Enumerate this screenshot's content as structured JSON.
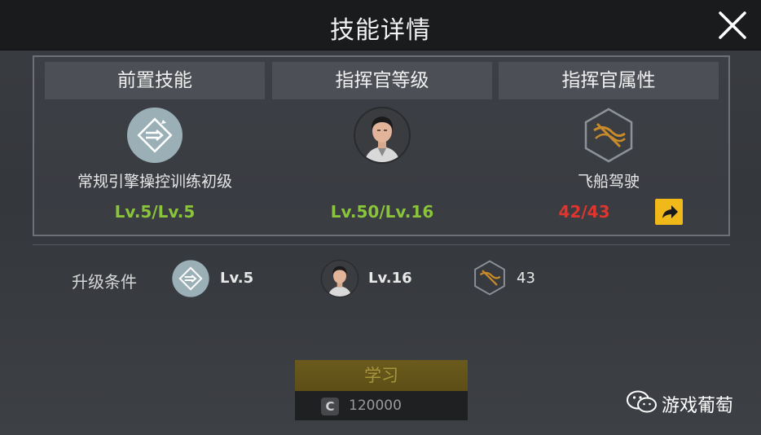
{
  "header": {
    "title": "技能详情"
  },
  "columns": [
    {
      "header": "前置技能",
      "name": "常规引擎操控训练初级",
      "level": "Lv.5/Lv.5",
      "icon": "engine-skill-icon"
    },
    {
      "header": "指挥官等级",
      "name": "",
      "level": "Lv.50/Lv.16",
      "icon": "commander-portrait"
    },
    {
      "header": "指挥官属性",
      "name": "飞船驾驶",
      "level": "42/43",
      "icon": "ship-piloting-icon"
    }
  ],
  "requirements": {
    "label": "升级条件",
    "items": [
      {
        "icon": "engine-skill-icon",
        "value": "Lv.5"
      },
      {
        "icon": "commander-portrait",
        "value": "Lv.16"
      },
      {
        "icon": "ship-piloting-icon",
        "value": "43"
      }
    ]
  },
  "learn": {
    "label": "学习",
    "currency_symbol": "C",
    "cost": "120000"
  },
  "watermark": {
    "text": "游戏葡萄"
  },
  "colors": {
    "met": "#89c43a",
    "unmet": "#e0352e",
    "accent": "#f0b818"
  }
}
